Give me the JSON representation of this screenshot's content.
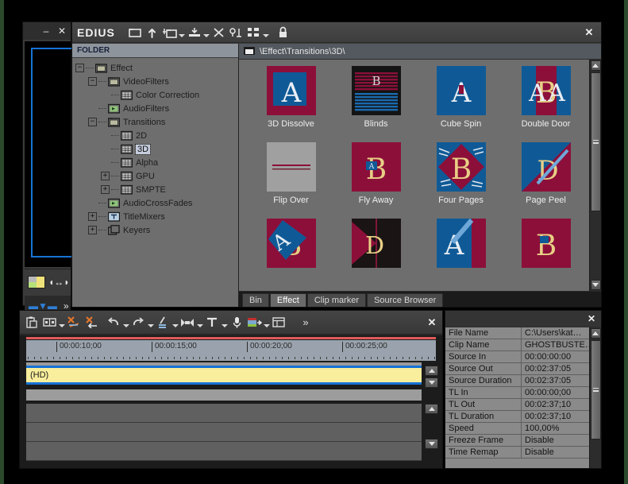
{
  "player": {
    "title_buttons": [
      "–",
      "✕"
    ],
    "icons": [
      "color-swatch-icon",
      "fit-width-icon",
      "marker-icon",
      "expand-icon"
    ]
  },
  "effect_window": {
    "app_name": "EDIUS",
    "close_label": "✕",
    "toolbar_icons": [
      "open-folder-icon",
      "up-folder-icon",
      "new-folder-icon",
      "import-icon",
      "delete-icon",
      "rename-icon",
      "view-mode-icon",
      "lock-icon"
    ],
    "folder_header": "FOLDER",
    "breadcrumb": "\\Effect\\Transitions\\3D\\",
    "breadcrumb_icon": "folder-icon",
    "tree": [
      {
        "label": "Effect",
        "depth": 0,
        "expander": "−",
        "icon": "folder-icon",
        "selected": false
      },
      {
        "label": "VideoFilters",
        "depth": 1,
        "expander": "−",
        "icon": "video-filter-icon",
        "selected": false
      },
      {
        "label": "Color Correction",
        "depth": 2,
        "expander": "",
        "icon": "grid-icon",
        "selected": false
      },
      {
        "label": "AudioFilters",
        "depth": 1,
        "expander": "",
        "icon": "audio-filter-icon",
        "selected": false
      },
      {
        "label": "Transitions",
        "depth": 1,
        "expander": "−",
        "icon": "transition-icon",
        "selected": false
      },
      {
        "label": "2D",
        "depth": 2,
        "expander": "",
        "icon": "grid-icon",
        "selected": false
      },
      {
        "label": "3D",
        "depth": 2,
        "expander": "",
        "icon": "grid-icon",
        "selected": true
      },
      {
        "label": "Alpha",
        "depth": 2,
        "expander": "",
        "icon": "grid-icon",
        "selected": false
      },
      {
        "label": "GPU",
        "depth": 2,
        "expander": "+",
        "icon": "grid-icon",
        "selected": false
      },
      {
        "label": "SMPTE",
        "depth": 2,
        "expander": "+",
        "icon": "grid-icon",
        "selected": false
      },
      {
        "label": "AudioCrossFades",
        "depth": 1,
        "expander": "",
        "icon": "crossfade-icon",
        "selected": false
      },
      {
        "label": "TitleMixers",
        "depth": 1,
        "expander": "+",
        "icon": "title-icon",
        "selected": false
      },
      {
        "label": "Keyers",
        "depth": 1,
        "expander": "+",
        "icon": "keyer-icon",
        "selected": false
      }
    ],
    "effects": [
      {
        "name": "3D Dissolve",
        "thumb": "dissolve"
      },
      {
        "name": "Blinds",
        "thumb": "blinds"
      },
      {
        "name": "Cube Spin",
        "thumb": "cubespin"
      },
      {
        "name": "Double Door",
        "thumb": "doubledoor"
      },
      {
        "name": "Flip Over",
        "thumb": "flipover"
      },
      {
        "name": "Fly Away",
        "thumb": "flyaway"
      },
      {
        "name": "Four Pages",
        "thumb": "fourpages"
      },
      {
        "name": "Page Peel",
        "thumb": "pagepeel"
      },
      {
        "name": "",
        "thumb": "row3a"
      },
      {
        "name": "",
        "thumb": "row3b"
      },
      {
        "name": "",
        "thumb": "row3c"
      },
      {
        "name": "",
        "thumb": "row3d"
      }
    ],
    "tabs": [
      {
        "label": "Bin",
        "active": false
      },
      {
        "label": "Effect",
        "active": true
      },
      {
        "label": "Clip marker",
        "active": false
      },
      {
        "label": "Source Browser",
        "active": false
      }
    ]
  },
  "timeline": {
    "close_label": "✕",
    "toolbar_icons": [
      "paste-icon",
      "duplicate-icon",
      "ripple-delete-icon",
      "delete-in-out-icon",
      "undo-icon",
      "redo-icon",
      "cut-icon",
      "match-frame-icon",
      "title-icon",
      "voice-over-icon",
      "mixer-icon",
      "track-panel-icon",
      "expand-icon"
    ],
    "ruler_labels": [
      "00:00:10;00",
      "00:00:15;00",
      "00:00:20;00",
      "00:00:25;00"
    ],
    "clip_label": "(HD)"
  },
  "info": {
    "close_label": "✕",
    "rows": [
      {
        "key": "File Name",
        "value": "C:\\Users\\kat…"
      },
      {
        "key": "Clip Name",
        "value": "GHOSTBUSTE…"
      },
      {
        "key": "Source In",
        "value": "00:00:00:00"
      },
      {
        "key": "Source Out",
        "value": "00:02:37:05"
      },
      {
        "key": "Source Duration",
        "value": "00:02:37:05"
      },
      {
        "key": "TL In",
        "value": "00:00:00;00"
      },
      {
        "key": "TL Out",
        "value": "00:02:37;10"
      },
      {
        "key": "TL Duration",
        "value": "00:02:37;10"
      },
      {
        "key": "Speed",
        "value": "100,00%"
      },
      {
        "key": "Freeze Frame",
        "value": "Disable"
      },
      {
        "key": "Time Remap",
        "value": "Disable"
      }
    ]
  },
  "colors": {
    "crimson": "#8c0f3a",
    "blue": "#0f5a96",
    "gold": "#e8cf85",
    "clip_yellow": "#f9ee9c",
    "clip_border": "#1673d6",
    "selection": "#c3cbdc",
    "playhead_red": "#e05a5a"
  }
}
